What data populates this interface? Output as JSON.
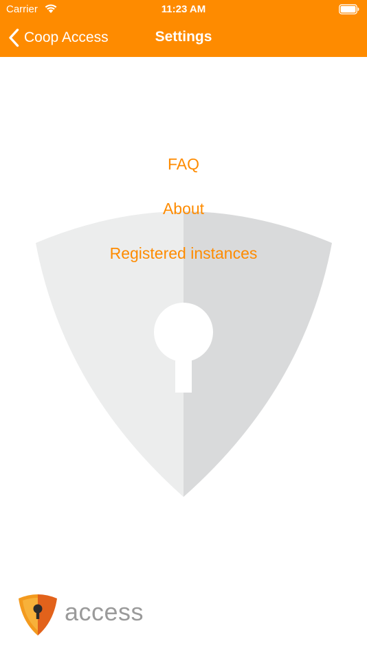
{
  "status_bar": {
    "carrier": "Carrier",
    "time": "11:23 AM",
    "icons": [
      "wifi-icon",
      "battery-icon"
    ]
  },
  "nav_bar": {
    "back_label": "Coop Access",
    "back_icon": "chevron-left-icon",
    "title": "Settings"
  },
  "menu": {
    "items": [
      {
        "label": "FAQ"
      },
      {
        "label": "About"
      },
      {
        "label": "Registered instances"
      }
    ]
  },
  "branding": {
    "logo_icon": "shield-keyhole-icon",
    "name": "access"
  },
  "colors": {
    "accent": "#fe8b00",
    "shield_light": "#eceded",
    "shield_dark": "#d9dadb",
    "brand_text": "#9a9a9a"
  }
}
